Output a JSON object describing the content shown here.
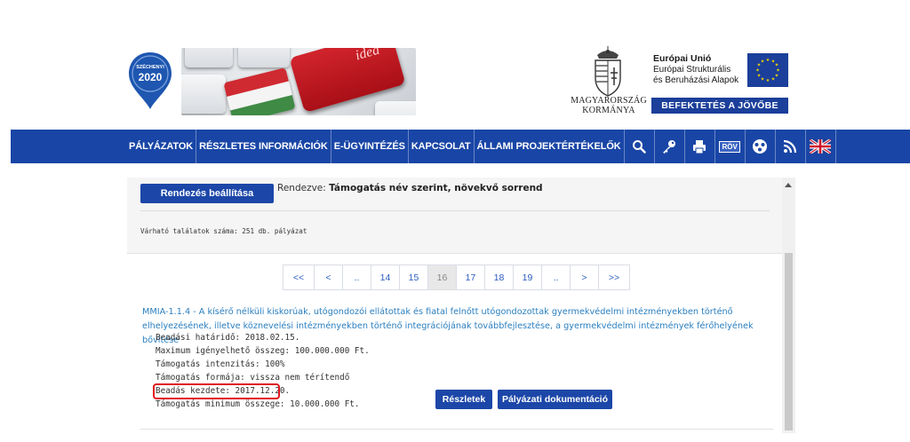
{
  "header": {
    "logo_line1": "SZÉCHENYI",
    "logo_line2": "2020",
    "banner_key_text": "idea",
    "gov_line1": "MAGYARORSZÁG",
    "gov_line2": "KORMÁNYA",
    "eu_title": "Európai Unió",
    "eu_sub1": "Európai Strukturális",
    "eu_sub2": "és Beruházási Alapok",
    "eu_motto": "BEFEKTETÉS A JÖVŐBE"
  },
  "nav": {
    "items": [
      "PÁLYÁZATOK",
      "RÉSZLETES INFORMÁCIÓK",
      "E-ÜGYINTÉZÉS",
      "KAPCSOLAT",
      "ÁLLAMI PROJEKTÉRTÉKELŐK"
    ],
    "icons": [
      "search-icon",
      "key-icon",
      "print-icon",
      "rov-icon",
      "accessibility-icon",
      "rss-icon",
      "uk-flag-icon"
    ],
    "rov_label": "RÖV"
  },
  "panel": {
    "sort_button": "Rendezés beállítása",
    "sort_prefix": "Rendezve: ",
    "sort_value": "Támogatás név szerint, növekvő sorrend",
    "result_count": "Várható találatok száma: 251 db. pályázat"
  },
  "pagination": [
    "<<",
    "<",
    "..",
    "14",
    "15",
    "16",
    "17",
    "18",
    "19",
    "..",
    ">",
    ">>"
  ],
  "pagination_active": "16",
  "result": {
    "title": "MMIA-1.1.4 - A kísérő nélküli kiskorúak, utógondozói ellátottak és fiatal felnőtt utógondozottak gyermekvédelmi intézményekben történő elhelyezésének, illetve köznevelési intézményekben történő integrációjának továbbfejlesztése, a gyermekvédelmi intézmények férőhelyének bővítése",
    "deadline": "Beadási határidő: 2018.02.15.",
    "max_amount": "Maximum igényelhető összeg: 100.000.000 Ft.",
    "intensity": "Támogatás intenzitás: 100%",
    "form": "Támogatás formája: vissza nem térítendő",
    "start": "Beadás kezdete: 2017.12.20.",
    "min_amount": "Támogatás minimum összege: 10.000.000 Ft.",
    "details_button": "Részletek",
    "docs_button": "Pályázati dokumentáció"
  },
  "colors": {
    "nav_blue": "#1946a6",
    "button_blue": "#1c47a8",
    "link_blue": "#2a7fc0",
    "highlight_red": "#e0151d",
    "eu_blue": "#1b3f9a"
  }
}
